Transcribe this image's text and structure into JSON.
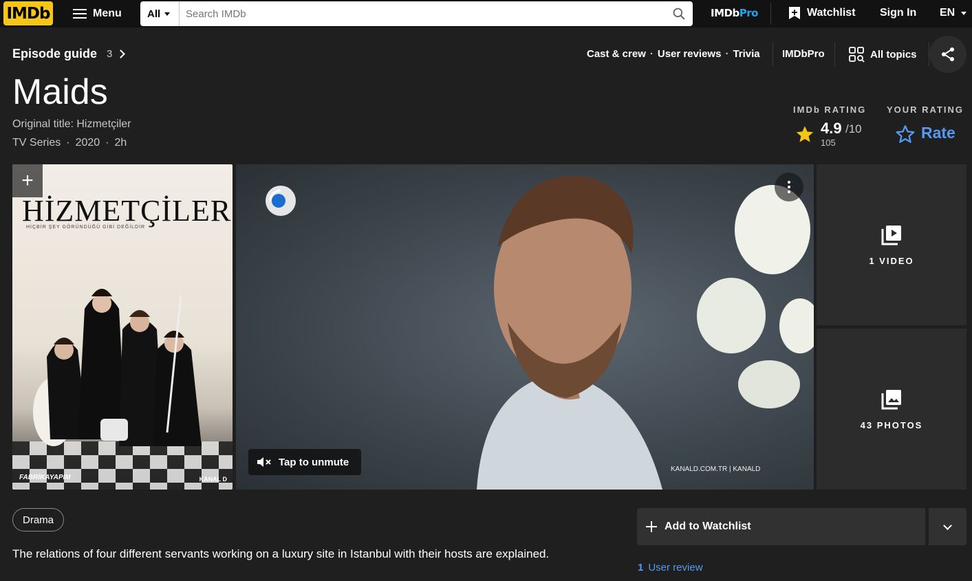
{
  "nav": {
    "logo": "IMDb",
    "menu_label": "Menu",
    "search_category": "All",
    "search_placeholder": "Search IMDb",
    "imdbpro_a": "IMDb",
    "imdbpro_b": "Pro",
    "watchlist": "Watchlist",
    "signin": "Sign In",
    "lang": "EN"
  },
  "subnav": {
    "episode_guide": "Episode guide",
    "episode_count": "3",
    "cast_crew": "Cast & crew",
    "user_reviews": "User reviews",
    "trivia": "Trivia",
    "imdbpro": "IMDbPro",
    "all_topics": "All topics"
  },
  "title": {
    "name": "Maids",
    "original_title": "Original title: Hizmetçiler",
    "type": "TV Series",
    "year": "2020",
    "runtime": "2h"
  },
  "rating": {
    "imdb_label": "IMDb RATING",
    "value": "4.9",
    "max": "/10",
    "count": "105",
    "your_label": "YOUR RATING",
    "rate": "Rate"
  },
  "poster": {
    "title": "HİZMETÇİLER",
    "tagline": "HİÇBİR ŞEY GÖRÜNDÜĞÜ GİBİ DEĞİLDİR",
    "brand_left": "FABRİKAYAPIM",
    "brand_right": "KANAL D"
  },
  "video": {
    "unmute": "Tap to unmute",
    "watermark": "KANALD.COM.TR | KANALD"
  },
  "tiles": {
    "videos": "1 VIDEO",
    "photos": "43 PHOTOS"
  },
  "details": {
    "genre": "Drama",
    "plot": "The relations of four different servants working on a luxury site in Istanbul with their hosts are explained.",
    "add_watchlist": "Add to Watchlist",
    "review_count": "1",
    "review_label": "User review"
  },
  "colors": {
    "brand": "#f5c518",
    "link": "#5799ef",
    "background": "#1f1f1f"
  }
}
